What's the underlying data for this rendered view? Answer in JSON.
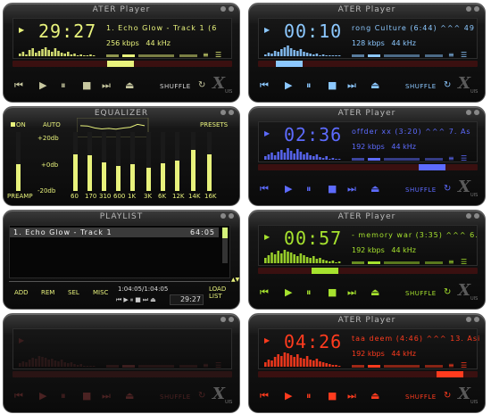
{
  "colors": {
    "yellow": "#e8f27c",
    "cyan": "#8cc8ff",
    "blue": "#5d6bff",
    "green": "#a6e22e",
    "red": "#ff3b1e",
    "dim": "#4a2222"
  },
  "icons": {
    "prev": "⏮",
    "play": "▶",
    "pause": "⏸",
    "stop": "■",
    "next": "⏭",
    "eject": "⏏",
    "repeat": "↻",
    "play_indicator": "▶"
  },
  "logo": {
    "mark": "X",
    "sub": "UIS"
  },
  "players": [
    {
      "title": "ATER Player",
      "time": "29:27",
      "song": "1. Echo Glow - Track  1 (6",
      "kbps": "256 kbps",
      "khz": "44 kHz",
      "shuffle_label": "SHUFFLE"
    },
    {
      "title": "ATER Player",
      "time": "00:10",
      "song": "rong Culture (6:44) ^^^  49",
      "kbps": "128 kbps",
      "khz": "44 kHz",
      "shuffle_label": "SHUFFLE"
    },
    {
      "title": "ATER Player",
      "time": "02:36",
      "song": "offder xx (3:20) ^^^  7. As",
      "kbps": "192 kbps",
      "khz": "44 kHz",
      "shuffle_label": "SHUFFLE"
    },
    {
      "title": "ATER Player",
      "time": "00:57",
      "song": "- memory war (3:35) ^^^  6.",
      "kbps": "192 kbps",
      "khz": "44 kHz",
      "shuffle_label": "SHUFFLE"
    },
    {
      "title": "ATER Player",
      "time": "04:26",
      "song": "taa deem (4:46) ^^^  13. Asi",
      "kbps": "192 kbps",
      "khz": "44 kHz",
      "shuffle_label": "SHUFFLE"
    },
    {
      "title": "",
      "time": "",
      "song": "",
      "kbps": "",
      "khz": "",
      "shuffle_label": "SHUFFLE"
    }
  ],
  "equalizer": {
    "title": "EQUALIZER",
    "on_label": "ON",
    "auto_label": "AUTO",
    "presets_label": "PRESETS",
    "db_top": "+20db",
    "db_mid": "+0db",
    "db_bot": "-20db",
    "preamp_label": "PREAMP",
    "bands": [
      "60",
      "170",
      "310",
      "600",
      "1K",
      "3K",
      "6K",
      "12K",
      "14K",
      "16K"
    ],
    "preamp_level": 0.45,
    "band_levels": [
      0.62,
      0.6,
      0.48,
      0.42,
      0.45,
      0.4,
      0.47,
      0.52,
      0.7,
      0.62
    ]
  },
  "playlist": {
    "title": "PLAYLIST",
    "items": [
      {
        "name": "1. Echo Glow - Track  1",
        "duration": "64:05"
      }
    ],
    "total": "1:04:05/1:04:05",
    "time": "29:27",
    "buttons": {
      "add": "ADD",
      "rem": "REM",
      "sel": "SEL",
      "misc": "MISC",
      "load": "LOAD",
      "list": "LIST"
    }
  }
}
